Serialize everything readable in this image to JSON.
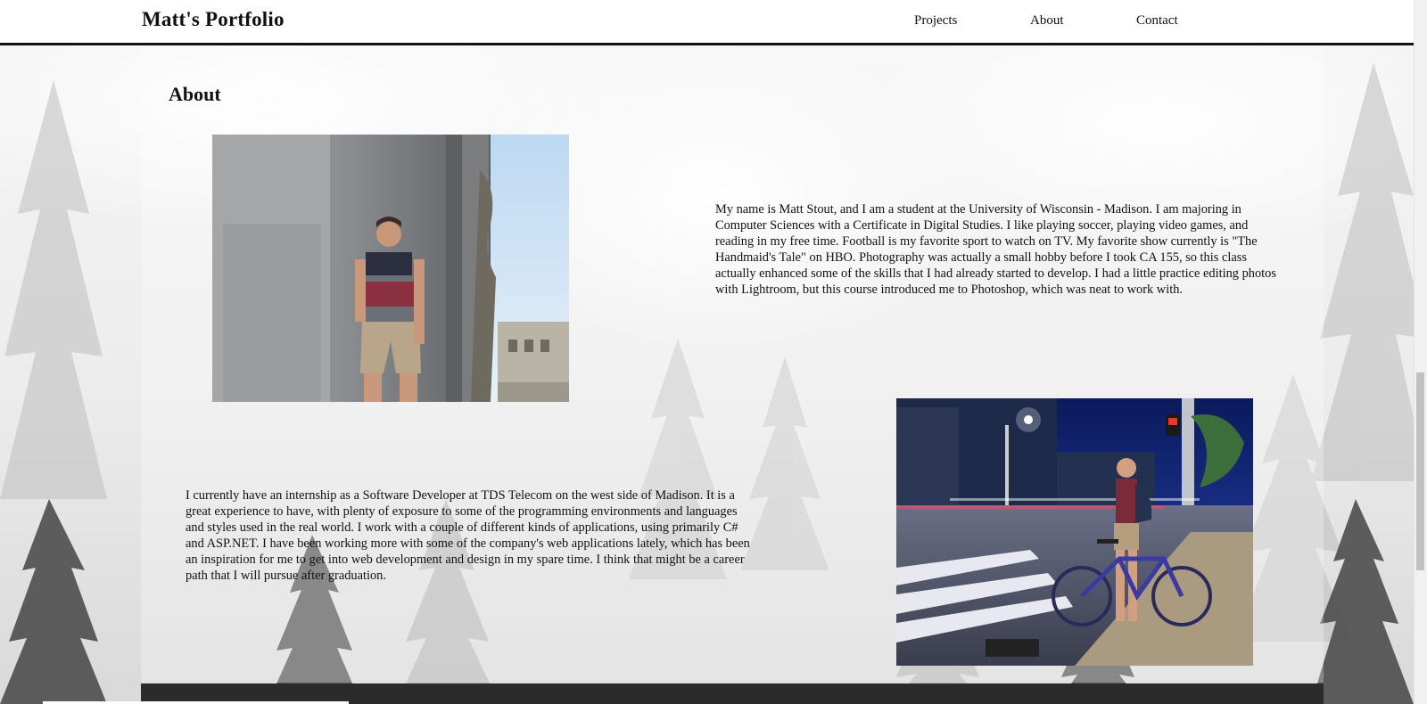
{
  "header": {
    "brand": "Matt's Portfolio",
    "nav": [
      "Projects",
      "About",
      "Contact"
    ]
  },
  "about": {
    "heading": "About",
    "paragraph1": "My name is Matt Stout, and I am a student at the University of Wisconsin - Madison. I am majoring in Computer Sciences with a Certificate in Digital Studies. I like playing soccer, playing video games, and reading in my free time. Football is my favorite sport to watch on TV. My favorite show currently is \"The Handmaid's Tale\" on HBO. Photography was actually a small hobby before I took CA 155, so this class actually enhanced some of the skills that I had already started to develop. I had a little practice editing photos with Lightroom, but this course introduced me to Photoshop, which was neat to work with.",
    "paragraph2": "I currently have an internship as a Software Developer at TDS Telecom on the west side of Madison. It is a great experience to have, with plenty of exposure to some of the programming environments and languages and styles used in the real world. I work with a couple of different kinds of applications, using primarily C# and ASP.NET. I have been working more with some of the company's web applications lately, which has been an inspiration for me to get into web development and design in my spare time. I think that might be a career path that I will pursue after graduation."
  },
  "colors": {
    "header_bg": "#ffffff",
    "header_border": "#111111",
    "text": "#111111"
  }
}
